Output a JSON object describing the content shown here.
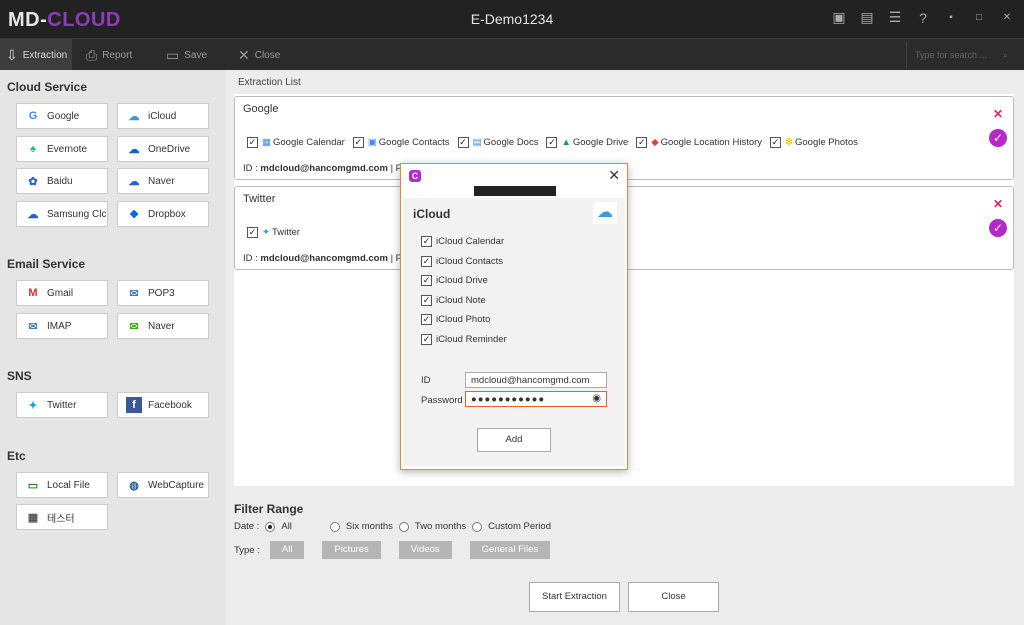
{
  "app": {
    "logo_a": "MD-",
    "logo_b": "CLOUD",
    "title": "E-Demo1234"
  },
  "window_icons": [
    "monitor-icon",
    "report-check-icon",
    "sliders-icon",
    "help-icon",
    "minimize-icon",
    "maximize-icon",
    "close-icon"
  ],
  "toolbar": {
    "extraction": "Extraction",
    "report": "Report",
    "save": "Save",
    "close": "Close",
    "search_placeholder": "Type for search ..."
  },
  "sidebar": {
    "cloud_title": "Cloud Service",
    "cloud": [
      "Google",
      "iCloud",
      "Evernote",
      "OneDrive",
      "Baidu",
      "Naver",
      "Samsung Clc",
      "Dropbox"
    ],
    "email_title": "Email Service",
    "email": [
      "Gmail",
      "POP3",
      "IMAP",
      "Naver"
    ],
    "sns_title": "SNS",
    "sns": [
      "Twitter",
      "Facebook"
    ],
    "etc_title": "Etc",
    "etc": [
      "Local File",
      "WebCapture",
      "테스터"
    ]
  },
  "main": {
    "list_header": "Extraction List",
    "google_card": {
      "name": "Google",
      "items": [
        "Google Calendar",
        "Google Contacts",
        "Google Docs",
        "Google Drive",
        "Google Location History",
        "Google Photos"
      ],
      "id_label": "ID :",
      "id_value": "mdcloud@hancomgmd.com",
      "sep": "|",
      "pw_label": "Pa"
    },
    "twitter_card": {
      "name": "Twitter",
      "items": [
        "Twitter"
      ],
      "id_label": "ID :",
      "id_value": "mdcloud@hancomgmd.com",
      "sep": "|",
      "pw_label": "Pa"
    },
    "filter": {
      "title": "Filter Range",
      "date_label": "Date :",
      "date_options": [
        "All",
        "Six months",
        "Two months",
        "Custom Period"
      ],
      "date_selected": "All",
      "type_label": "Type :",
      "types": [
        "All",
        "Pictures",
        "Videos",
        "General Files"
      ]
    },
    "start_button": "Start Extraction",
    "close_button": "Close"
  },
  "modal": {
    "logo": "C",
    "title": "iCloud",
    "items": [
      "iCloud Calendar",
      "iCloud Contacts",
      "iCloud Drive",
      "iCloud Note",
      "iCloud Photo",
      "iCloud Reminder"
    ],
    "id_label": "ID",
    "id_value": "mdcloud@hancomgmd.com",
    "password_label": "Password",
    "password_value": "●●●●●●●●●●●",
    "add_button": "Add"
  },
  "colors": {
    "accent": "#b329c9",
    "titlebar": "#222222",
    "sidebar": "#e5e5e5",
    "remove": "#e0245e",
    "dialog_border": "#e08a3c"
  }
}
